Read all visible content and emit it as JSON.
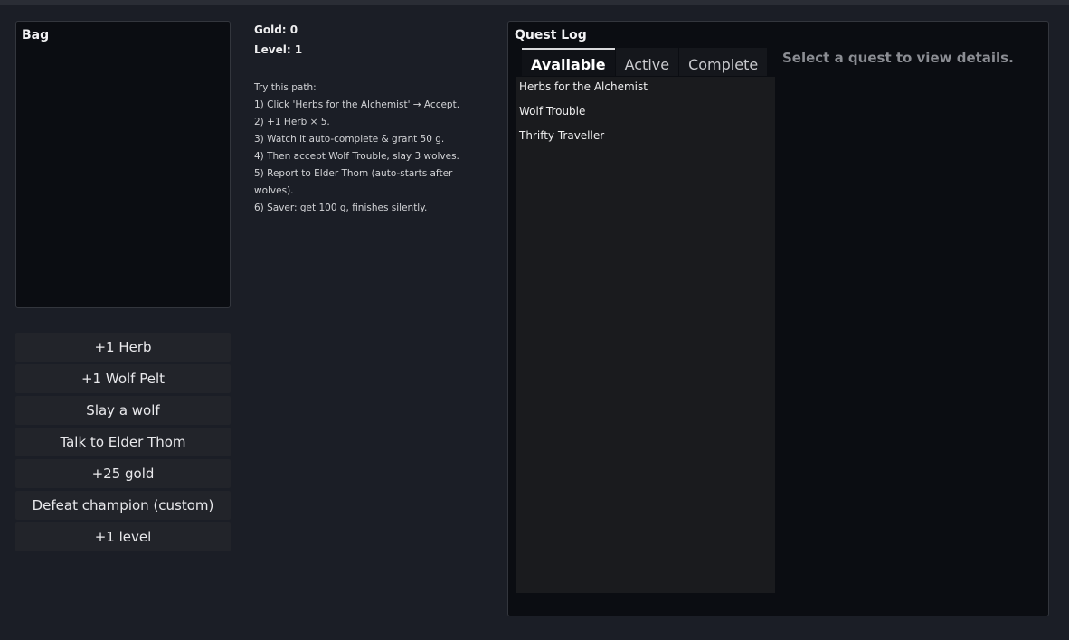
{
  "bag": {
    "title": "Bag"
  },
  "actions": [
    "+1 Herb",
    "+1 Wolf Pelt",
    "Slay a wolf",
    "Talk to Elder Thom",
    "+25 gold",
    "Defeat champion (custom)",
    "+1 level"
  ],
  "stats": {
    "gold": "Gold: 0",
    "level": "Level: 1"
  },
  "hint": {
    "heading": "Try this path:",
    "steps": [
      "1) Click 'Herbs for the Alchemist' → Accept.",
      "2) +1 Herb × 5.",
      "3) Watch it auto-complete & grant 50 g.",
      "4) Then accept Wolf Trouble, slay 3 wolves.",
      "5) Report to Elder Thom (auto-starts after",
      "wolves).",
      "6) Saver: get 100 g, finishes silently."
    ]
  },
  "quest_log": {
    "title": "Quest Log",
    "tabs": [
      "Available",
      "Active",
      "Complete"
    ],
    "active_tab": "Available",
    "quests": [
      "Herbs for the Alchemist",
      "Wolf Trouble",
      "Thrifty Traveller"
    ],
    "details_placeholder": "Select a quest to view details."
  }
}
